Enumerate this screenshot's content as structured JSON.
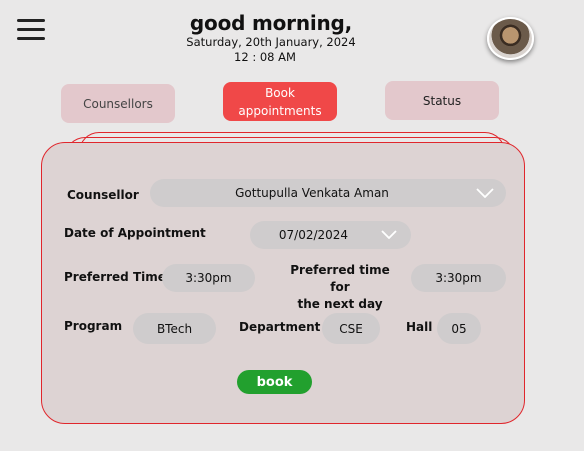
{
  "header": {
    "greeting": "good morning,",
    "date": "Saturday, 20th January, 2024",
    "time": "12 : 08 AM"
  },
  "icons": {
    "menu": "hamburger-menu-icon",
    "dropdown": "chevron-down-icon",
    "profile": "avatar"
  },
  "tabs": {
    "counsellors": "Counsellors",
    "book_line1": "Book",
    "book_line2": "appointments",
    "status": "Status"
  },
  "form": {
    "counsellor_label": "Counsellor",
    "counsellor_value": "Gottupulla Venkata Aman",
    "date_label": "Date of Appointment",
    "date_value": "07/02/2024",
    "time_label": "Preferred Time",
    "time_value": "3:30pm",
    "next_time_label_line1": "Preferred time for",
    "next_time_label_line2": "the next day",
    "next_time_value": "3:30pm",
    "program_label": "Program",
    "program_value": "BTech",
    "department_label": "Department",
    "department_value": "CSE",
    "hall_label": "Hall",
    "hall_value": "05",
    "submit_label": "book"
  },
  "colors": {
    "background": "#e9e8e8",
    "active_tab": "#f04848",
    "inactive_tab": "#e3c8cc",
    "card_border": "#e0262c",
    "card_fill": "#ddd3d3",
    "submit": "#22a02e"
  }
}
